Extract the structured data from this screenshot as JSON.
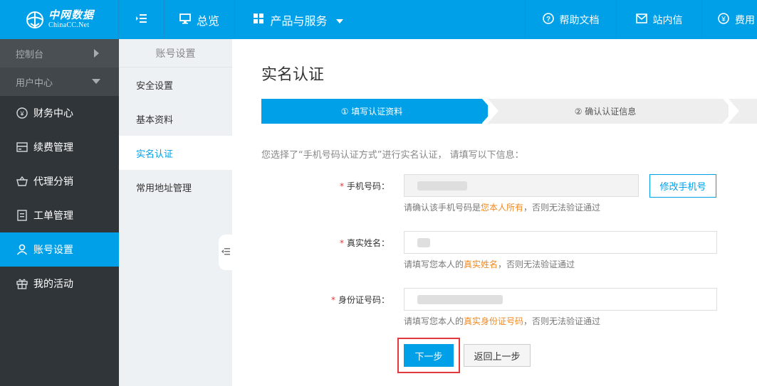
{
  "brand": {
    "name_cn": "中网数据",
    "name_en": "ChinaCC.Net"
  },
  "topbar": {
    "menu_icon": "indent-icon",
    "overview": "总览",
    "products": "产品与服务",
    "help": "帮助文档",
    "messages": "站内信",
    "billing": "费用"
  },
  "sidebar": {
    "console": "控制台",
    "user_center": "用户中心",
    "items": [
      {
        "label": "财务中心",
        "icon": "yen-circle-icon"
      },
      {
        "label": "续费管理",
        "icon": "card-icon"
      },
      {
        "label": "代理分销",
        "icon": "basket-icon"
      },
      {
        "label": "工单管理",
        "icon": "document-icon"
      },
      {
        "label": "账号设置",
        "icon": "user-icon",
        "active": true
      },
      {
        "label": "我的活动",
        "icon": "gift-icon"
      }
    ]
  },
  "submenu": {
    "title": "账号设置",
    "items": [
      {
        "label": "安全设置"
      },
      {
        "label": "基本资料"
      },
      {
        "label": "实名认证",
        "active": true
      },
      {
        "label": "常用地址管理"
      }
    ]
  },
  "main": {
    "title": "实名认证",
    "steps": [
      {
        "label": "① 填写认证资料",
        "active": true
      },
      {
        "label": "② 确认认证信息",
        "active": false
      }
    ],
    "intro": "您选择了“手机号码认证方式”进行实名认证， 请填写以下信息：",
    "phone": {
      "label": "手机号码：",
      "change_button": "修改手机号",
      "hint_prefix": "请确认该手机号码是",
      "hint_highlight": "您本人所有",
      "hint_suffix": "，否则无法验证通过"
    },
    "name": {
      "label": "真实姓名：",
      "hint_prefix": "请填写您本人的",
      "hint_highlight": "真实姓名",
      "hint_suffix": "，否则无法验证通过"
    },
    "id_card": {
      "label": "身份证号码：",
      "hint_prefix": "请填写您本人的",
      "hint_highlight": "真实身份证号码",
      "hint_suffix": "，否则无法验证通过"
    },
    "next_button": "下一步",
    "back_button": "返回上一步"
  },
  "colors": {
    "primary": "#00a0e9",
    "sidebar_bg": "#30353a",
    "required": "#e4393c",
    "highlight": "#f08a24"
  }
}
